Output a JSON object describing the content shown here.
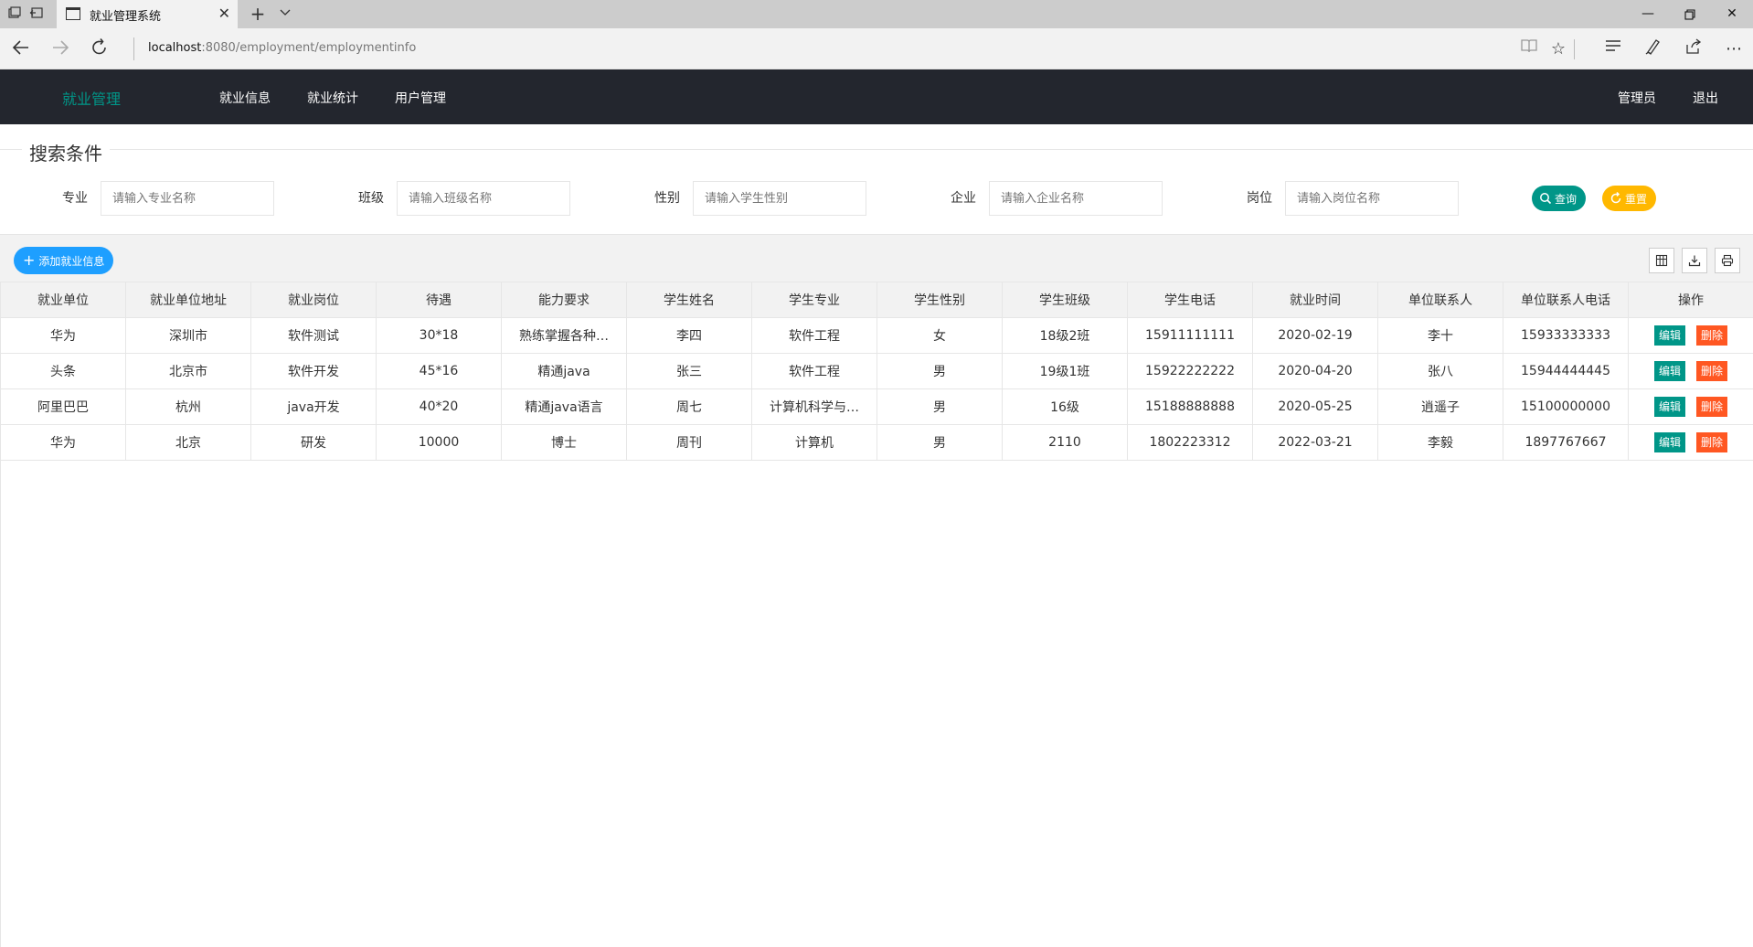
{
  "browser": {
    "tab_title": "就业管理系统",
    "url_host": "localhost",
    "url_rest": ":8080/employment/employmentinfo"
  },
  "header": {
    "brand": "就业管理",
    "nav": [
      "就业信息",
      "就业统计",
      "用户管理"
    ],
    "user": "管理员",
    "logout": "退出"
  },
  "search": {
    "legend": "搜索条件",
    "fields": [
      {
        "label": "专业",
        "placeholder": "请输入专业名称"
      },
      {
        "label": "班级",
        "placeholder": "请输入班级名称"
      },
      {
        "label": "性别",
        "placeholder": "请输入学生性别"
      },
      {
        "label": "企业",
        "placeholder": "请输入企业名称"
      },
      {
        "label": "岗位",
        "placeholder": "请输入岗位名称"
      }
    ],
    "query_label": "查询",
    "reset_label": "重置"
  },
  "toolbar": {
    "add_label": "添加就业信息"
  },
  "table": {
    "columns": [
      "就业单位",
      "就业单位地址",
      "就业岗位",
      "待遇",
      "能力要求",
      "学生姓名",
      "学生专业",
      "学生性别",
      "学生班级",
      "学生电话",
      "就业时间",
      "单位联系人",
      "单位联系人电话",
      "操作"
    ],
    "rows": [
      [
        "华为",
        "深圳市",
        "软件测试",
        "30*18",
        "熟练掌握各种…",
        "李四",
        "软件工程",
        "女",
        "18级2班",
        "15911111111",
        "2020-02-19",
        "李十",
        "15933333333"
      ],
      [
        "头条",
        "北京市",
        "软件开发",
        "45*16",
        "精通java",
        "张三",
        "软件工程",
        "男",
        "19级1班",
        "15922222222",
        "2020-04-20",
        "张八",
        "15944444445"
      ],
      [
        "阿里巴巴",
        "杭州",
        "java开发",
        "40*20",
        "精通java语言",
        "周七",
        "计算机科学与…",
        "男",
        "16级",
        "15188888888",
        "2020-05-25",
        "逍遥子",
        "15100000000"
      ],
      [
        "华为",
        "北京",
        "研发",
        "10000",
        "博士",
        "周刊",
        "计算机",
        "男",
        "2110",
        "1802223312",
        "2022-03-21",
        "李毅",
        "1897767667"
      ]
    ],
    "edit_label": "编辑",
    "delete_label": "删除"
  },
  "colors": {
    "header_bg": "#23262e",
    "brand": "#009688",
    "query": "#009688",
    "reset": "#ffb800",
    "add": "#1e9fff",
    "delete": "#ff5722"
  }
}
